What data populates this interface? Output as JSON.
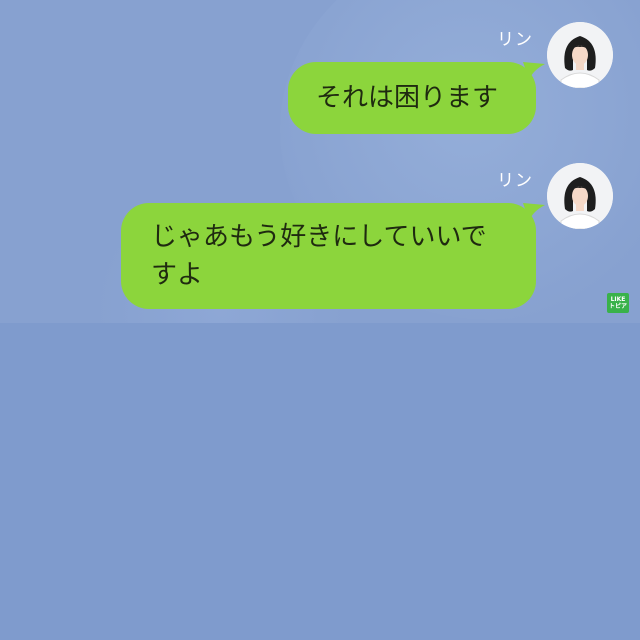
{
  "messages": [
    {
      "sender": "リン",
      "text": "それは困ります"
    },
    {
      "sender": "リン",
      "text": "じゃあもう好きにしていいですよ"
    }
  ],
  "watermark": {
    "line1": "LIKE",
    "line2": "トピア"
  },
  "colors": {
    "chat_background": "#87a1d0",
    "outer_background": "#7f9bcd",
    "bubble": "#8cd53c",
    "text": "#1f2a10",
    "watermark": "#39b24a"
  }
}
